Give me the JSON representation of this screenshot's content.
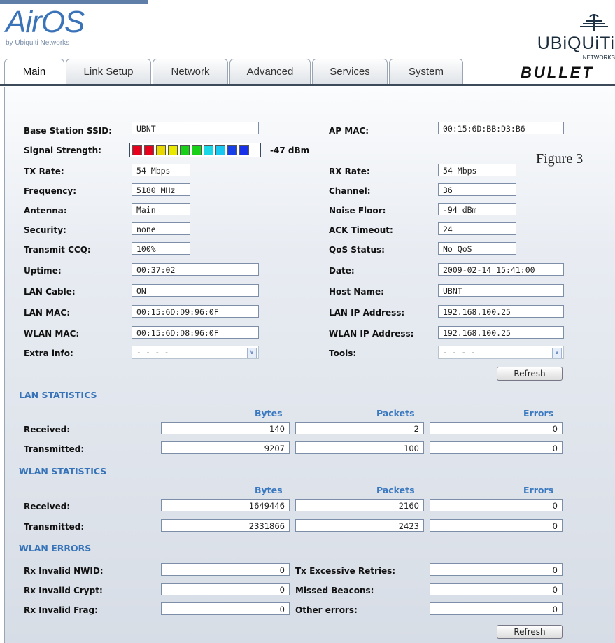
{
  "brand": {
    "product": "AirOS",
    "byline": "by Ubiquiti Networks",
    "vendor": "UBiQUiTi",
    "vendor_sub": "NETWORKS",
    "device": "BULLET",
    "brand_color": "#3b73b8"
  },
  "tabs": [
    {
      "label": "Main",
      "active": true
    },
    {
      "label": "Link Setup",
      "active": false
    },
    {
      "label": "Network",
      "active": false
    },
    {
      "label": "Advanced",
      "active": false
    },
    {
      "label": "Services",
      "active": false
    },
    {
      "label": "System",
      "active": false
    }
  ],
  "figure_label": "Figure 3",
  "status": {
    "left": [
      {
        "label": "Base Station SSID:",
        "value": "UBNT"
      },
      {
        "label": "Signal Strength:",
        "value": "-47 dBm"
      },
      {
        "label": "TX Rate:",
        "value": "54 Mbps"
      },
      {
        "label": "Frequency:",
        "value": "5180 MHz"
      },
      {
        "label": "Antenna:",
        "value": "Main"
      },
      {
        "label": "Security:",
        "value": "none"
      },
      {
        "label": "Transmit CCQ:",
        "value": "100%"
      },
      {
        "label": "Uptime:",
        "value": "00:37:02"
      },
      {
        "label": "LAN Cable:",
        "value": "ON"
      },
      {
        "label": "LAN MAC:",
        "value": "00:15:6D:D9:96:0F"
      },
      {
        "label": "WLAN MAC:",
        "value": "00:15:6D:D8:96:0F"
      },
      {
        "label": "Extra info:",
        "value": "- - - -"
      }
    ],
    "right": [
      {
        "label": "AP MAC:",
        "value": "00:15:6D:BB:D3:B6"
      },
      {
        "label": "RX Rate:",
        "value": "54 Mbps"
      },
      {
        "label": "Channel:",
        "value": "36"
      },
      {
        "label": "Noise Floor:",
        "value": "-94 dBm"
      },
      {
        "label": "ACK Timeout:",
        "value": "24"
      },
      {
        "label": "QoS Status:",
        "value": "No QoS"
      },
      {
        "label": "Date:",
        "value": "2009-02-14 15:41:00"
      },
      {
        "label": "Host Name:",
        "value": "UBNT"
      },
      {
        "label": "LAN IP Address:",
        "value": "192.168.100.25"
      },
      {
        "label": "WLAN IP Address:",
        "value": "192.168.100.25"
      },
      {
        "label": "Tools:",
        "value": "- - - -"
      }
    ],
    "signal_bars": [
      "#e8001c",
      "#e8001c",
      "#e8d800",
      "#e8e800",
      "#18d018",
      "#18d018",
      "#18d8e8",
      "#18c8f0",
      "#1840e8",
      "#1830e8"
    ],
    "refresh_label": "Refresh"
  },
  "lan_stats": {
    "title": "LAN STATISTICS",
    "columns": [
      "Bytes",
      "Packets",
      "Errors"
    ],
    "rows": [
      {
        "label": "Received:",
        "values": [
          "140",
          "2",
          "0"
        ]
      },
      {
        "label": "Transmitted:",
        "values": [
          "9207",
          "100",
          "0"
        ]
      }
    ]
  },
  "wlan_stats": {
    "title": "WLAN STATISTICS",
    "columns": [
      "Bytes",
      "Packets",
      "Errors"
    ],
    "rows": [
      {
        "label": "Received:",
        "values": [
          "1649446",
          "2160",
          "0"
        ]
      },
      {
        "label": "Transmitted:",
        "values": [
          "2331866",
          "2423",
          "0"
        ]
      }
    ]
  },
  "wlan_errors": {
    "title": "WLAN ERRORS",
    "rows": [
      {
        "left_label": "Rx Invalid NWID:",
        "left_value": "0",
        "right_label": "Tx Excessive Retries:",
        "right_value": "0"
      },
      {
        "left_label": "Rx Invalid Crypt:",
        "left_value": "0",
        "right_label": "Missed Beacons:",
        "right_value": "0"
      },
      {
        "left_label": "Rx Invalid Frag:",
        "left_value": "0",
        "right_label": "Other errors:",
        "right_value": "0"
      }
    ],
    "refresh_label": "Refresh"
  }
}
